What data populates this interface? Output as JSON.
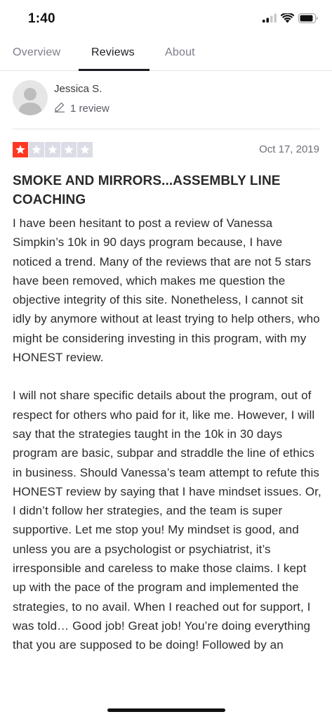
{
  "status_bar": {
    "time": "1:40"
  },
  "tabs": [
    {
      "label": "Overview",
      "active": false
    },
    {
      "label": "Reviews",
      "active": true
    },
    {
      "label": "About",
      "active": false
    }
  ],
  "reviewer": {
    "name": "Jessica S.",
    "review_count": "1 review"
  },
  "review": {
    "rating": 1,
    "max_rating": 5,
    "date": "Oct 17, 2019",
    "title": "SMOKE AND MIRRORS...ASSEMBLY LINE COACHING",
    "paragraphs": [
      "I have been hesitant to post a review of Vanessa Simpkin’s 10k in 90 days program because, I have noticed a trend. Many of the reviews that are not 5 stars have been removed, which makes me question the objective integrity of this site. Nonetheless, I cannot sit idly by anymore without at least trying to help others, who might be considering investing in this program, with my HONEST review.",
      "I will not share specific details about the program, out of respect for others who paid for it, like me. However, I will say that the strategies taught in the 10k in 30 days program are basic, subpar and straddle the line of ethics in business. Should Vanessa’s team attempt to refute this HONEST review by saying that I have mindset issues. Or, I didn’t follow her strategies, and the team is super supportive. Let me stop you! My mindset is good, and unless you are a psychologist or psychiatrist, it’s irresponsible and careless to make those claims. I kept up with the pace of the program and implemented the strategies, to no avail. When I reached out for support, I was told… Good job! Great job! You’re doing everything that you are supposed to be doing! Followed by an"
    ]
  },
  "colors": {
    "star_filled": "#ff3722",
    "star_empty": "#dcdce6",
    "tab_active": "#1b1b24",
    "tab_inactive": "#7d7d8a"
  }
}
